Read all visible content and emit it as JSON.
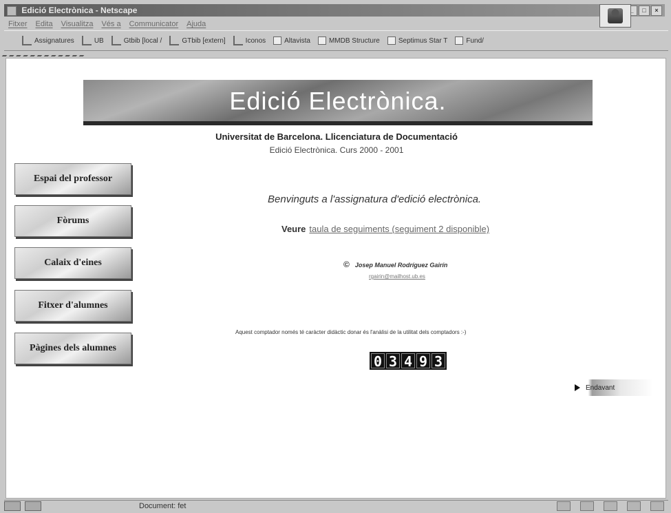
{
  "window": {
    "title": "Edició Electrònica - Netscape"
  },
  "menu": [
    "Fitxer",
    "Edita",
    "Visualitza",
    "Vés a",
    "Communicator",
    "Ajuda"
  ],
  "bookmarks": [
    "Assignatures",
    "UB",
    "Gtbib [local /",
    "GTbib [extern]",
    "Iconos",
    "Altavista",
    "MMDB Structure",
    "Septimus Star T",
    "Fund/"
  ],
  "page": {
    "banner_title": "Edició Electrònica.",
    "university": "Universitat de Barcelona. Llicenciatura de Documentació",
    "course": "Edició Electrònica. Curs 2000 - 2001",
    "nav": [
      "Espai del professor",
      "Fòrums",
      "Calaix d'eines",
      "Fitxer d'alumnes",
      "Pàgines dels alumnes"
    ],
    "welcome": "Benvinguts a l'assignatura d'edició electrònica.",
    "veure_label": "Veure",
    "veure_link": "taula de seguiments (seguiment 2 disponible)",
    "copyright_symbol": "©",
    "author": "Josep Manuel Rodríguez Gairín",
    "email": "rgairin@mailhost.ub.es",
    "counter_note": "Aquest comptador només té caràcter didàctic donar és l'anàlisi de la utilitat dels comptadors :-)",
    "counter_value": "03493",
    "endavant": "Endavant"
  },
  "status": {
    "text": "Document: fet"
  }
}
